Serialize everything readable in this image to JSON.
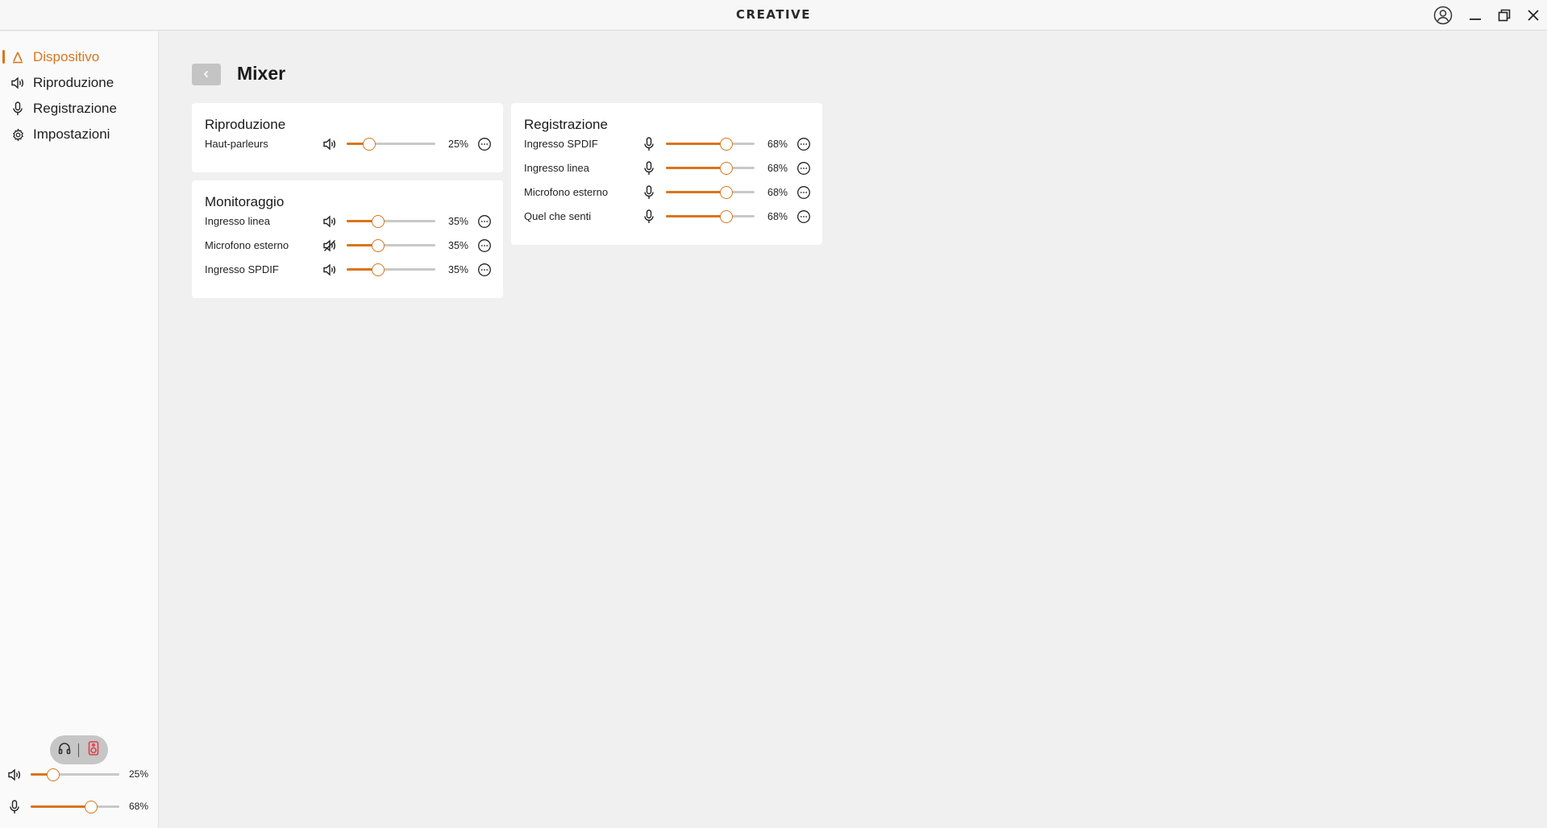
{
  "app": {
    "brand": "CREATIVE"
  },
  "window_controls": {
    "account": "account-icon",
    "minimize": "minimize-icon",
    "restore": "restore-icon",
    "close": "close-icon"
  },
  "sidebar": {
    "items": [
      {
        "label": "Dispositivo",
        "icon": "device-icon",
        "active": true
      },
      {
        "label": "Riproduzione",
        "icon": "speaker-icon",
        "active": false
      },
      {
        "label": "Registrazione",
        "icon": "microphone-icon",
        "active": false
      },
      {
        "label": "Impostazioni",
        "icon": "gear-icon",
        "active": false
      }
    ],
    "output_toggle": {
      "left": "headphones-icon",
      "right": "speaker-box-icon"
    },
    "playback_volume": {
      "value": 25,
      "text": "25%"
    },
    "record_volume": {
      "value": 68,
      "text": "68%"
    }
  },
  "main": {
    "title": "Mixer",
    "cards": {
      "playback": {
        "title": "Riproduzione",
        "rows": [
          {
            "label": "Haut-parleurs",
            "icon": "speaker-icon",
            "value": 25,
            "text": "25%"
          }
        ]
      },
      "monitoring": {
        "title": "Monitoraggio",
        "rows": [
          {
            "label": "Ingresso linea",
            "icon": "speaker-icon",
            "value": 35,
            "text": "35%"
          },
          {
            "label": "Microfono esterno",
            "icon": "speaker-muted-icon",
            "value": 35,
            "text": "35%"
          },
          {
            "label": "Ingresso SPDIF",
            "icon": "speaker-icon",
            "value": 35,
            "text": "35%"
          }
        ]
      },
      "recording": {
        "title": "Registrazione",
        "rows": [
          {
            "label": "Ingresso SPDIF",
            "icon": "microphone-icon",
            "value": 68,
            "text": "68%"
          },
          {
            "label": "Ingresso linea",
            "icon": "microphone-icon",
            "value": 68,
            "text": "68%"
          },
          {
            "label": "Microfono esterno",
            "icon": "microphone-icon",
            "value": 68,
            "text": "68%"
          },
          {
            "label": "Quel che senti",
            "icon": "microphone-icon",
            "value": 68,
            "text": "68%"
          }
        ]
      }
    }
  },
  "colors": {
    "accent": "#d9751c",
    "track": "#c8c8c8",
    "background": "#f0f0f0",
    "card": "#ffffff",
    "sidebar": "#fafafa"
  }
}
